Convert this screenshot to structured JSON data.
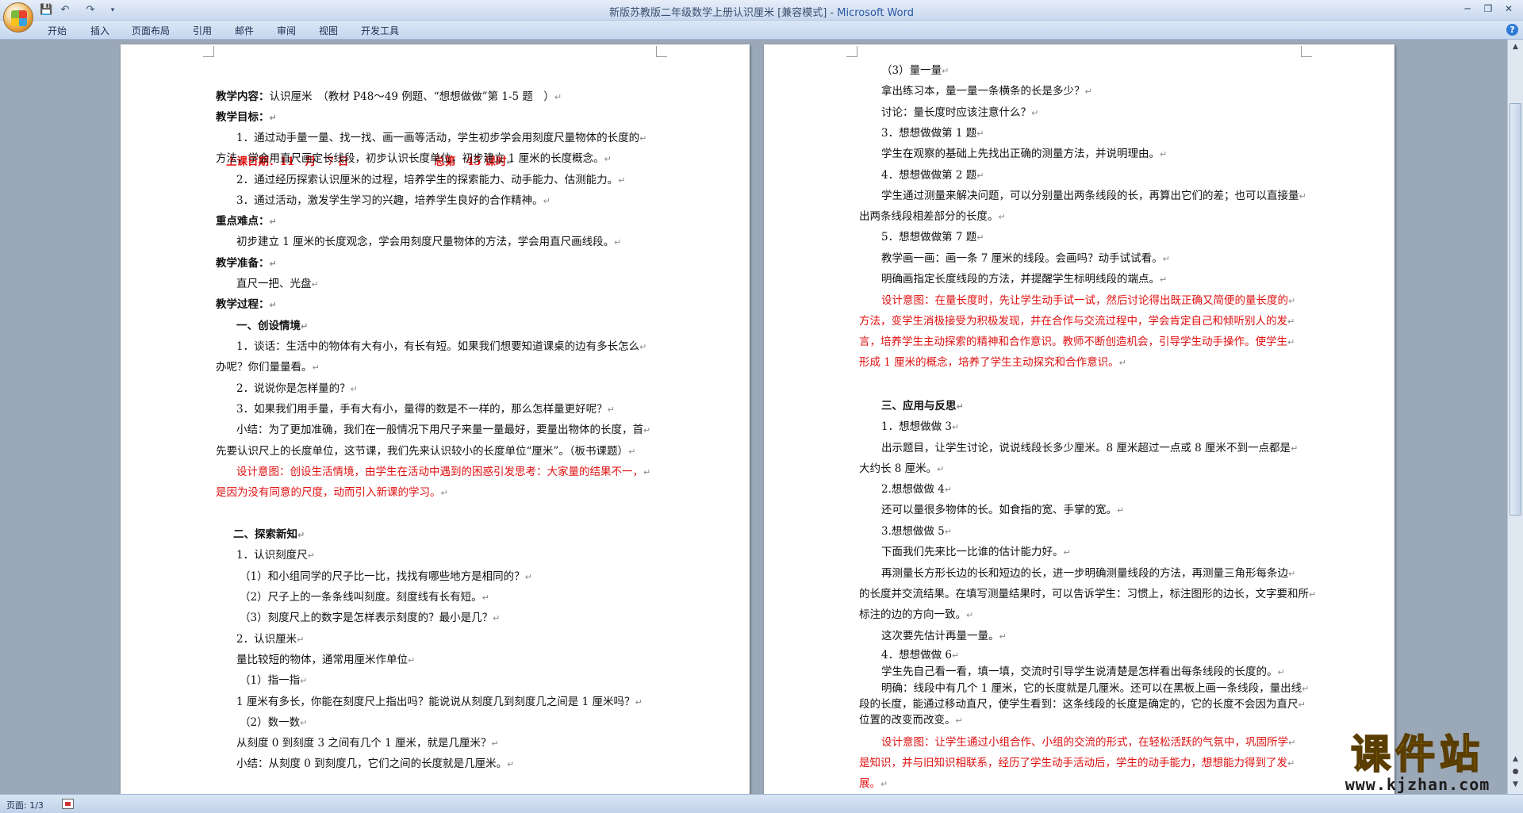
{
  "window": {
    "title": "新版苏教版二年级数学上册认识厘米 [兼容模式] - ",
    "app_name": "Microsoft Word",
    "quick_access": [
      "save-icon",
      "undo-icon",
      "redo-icon",
      "customize-icon"
    ],
    "controls": [
      "minimize",
      "restore",
      "close"
    ]
  },
  "ribbon": {
    "tabs": [
      "开始",
      "插入",
      "页面布局",
      "引用",
      "邮件",
      "审阅",
      "视图",
      "开发工具"
    ]
  },
  "status": {
    "page": "页面: 1/3"
  },
  "watermark": {
    "title": "课件站",
    "url": "www.kjzhan.com"
  },
  "page1": [
    "上课日期：11　月　7 日　　　　　　　　总第　45 课时",
    "教学内容：认识厘米　（教材 P48～49 例题、“想想做做”第 1-5 题　）",
    "教学目标：",
    "1．通过动手量一量、找一找、画一画等活动，学生初步学会用刻度尺量物体的长度的",
    "方法，学会用直尺画定长线段，初步认识长度单位，初步建立 1 厘米的长度概念。",
    "2．通过经历探索认识厘米的过程，培养学生的探索能力、动手能力、估测能力。",
    "3．通过活动，激发学生学习的兴趣，培养学生良好的合作精神。",
    "重点难点：",
    "初步建立 1 厘米的长度观念，学会用刻度尺量物体的方法，学会用直尺画线段。",
    "教学准备：",
    "直尺一把、光盘",
    "教学过程：",
    "一、创设情境",
    "1．谈话：生活中的物体有大有小，有长有短。如果我们想要知道课桌的边有多长怎么",
    "办呢？你们量量看。",
    "2．说说你是怎样量的？",
    "3．如果我们用手量，手有大有小，量得的数是不一样的，那么怎样量更好呢？",
    "小结：为了更加准确，我们在一般情况下用尺子来量一量最好，要量出物体的长度，首",
    "先要认识尺上的长度单位，这节课，我们先来认识较小的长度单位“厘米”。（板书课题）",
    "设计意图：创设生活情境，由学生在活动中遇到的困惑引发思考：大家量的结果不一，",
    "是因为没有同意的尺度，动而引入新课的学习。",
    "二、探索新知",
    "1．认识刻度尺",
    "（1）和小组同学的尺子比一比，找找有哪些地方是相同的？",
    "（2）尺子上的一条条线叫刻度。刻度线有长有短。",
    "（3）刻度尺上的数字是怎样表示刻度的？最小是几？",
    "2．认识厘米",
    "量比较短的物体，通常用厘米作单位",
    "（1）指一指",
    "1 厘米有多长，你能在刻度尺上指出吗？能说说从刻度几到刻度几之间是 1 厘米吗？",
    "（2）数一数",
    "从刻度 0 到刻度 3 之间有几个 1 厘米，就是几厘米？",
    "小结：从刻度 0 到刻度几，它们之间的长度就是几厘米。"
  ],
  "page2": [
    "（3）量一量",
    "拿出练习本，量一量一条横条的长是多少？",
    "讨论：量长度时应该注意什么？",
    "3．想想做做第 1 题",
    "学生在观察的基础上先找出正确的测量方法，并说明理由。",
    "4．想想做做第 2 题",
    "学生通过测量来解决问题，可以分别量出两条线段的长，再算出它们的差；也可以直接量",
    "出两条线段相差部分的长度。",
    "5．想想做做第 7 题",
    "教学画一画：画一条 7 厘米的线段。会画吗？动手试试看。",
    "明确画指定长度线段的方法，并提醒学生标明线段的端点。",
    "设计意图：在量长度时，先让学生动手试一试，然后讨论得出既正确又简便的量长度的",
    "方法，变学生消极接受为积极发现，并在合作与交流过程中，学会肯定自己和倾听别人的发",
    "言，培养学生主动探索的精神和合作意识。教师不断创造机会，引导学生动手操作。使学生",
    "形成 1 厘米的概念，培养了学生主动探究和合作意识。",
    "三、应用与反思",
    "1．想想做做 3",
    "出示题目，让学生讨论，说说线段长多少厘米。8 厘米超过一点或 8 厘米不到一点都是",
    "大约长 8 厘米。",
    "2.想想做做 4",
    "还可以量很多物体的长。如食指的宽、手掌的宽。",
    "3.想想做做 5",
    "下面我们先来比一比谁的估计能力好。",
    "再测量长方形长边的长和短边的长，进一步明确测量线段的方法，再测量三角形每条边",
    "的长度并交流结果。在填写测量结果时，可以告诉学生：习惯上，标注图形的边长，文字要和所",
    "标注的边的方向一致。",
    "这次要先估计再量一量。",
    "4．想想做做 6",
    "学生先自己看一看，填一填，交流时引导学生说清楚是怎样看出每条线段的长度的。",
    "明确：线段中有几个 1 厘米，它的长度就是几厘米。还可以在黑板上画一条线段，量出线",
    "段的长度，能通过移动直尺，使学生看到：这条线段的长度是确定的，它的长度不会因为直尺",
    "位置的改变而改变。",
    "设计意图：让学生通过小组合作、小组的交流的形式，在轻松活跃的气氛中，巩固所学",
    "是知识，并与旧知识相联系，经历了学生动手活动后，学生的动手能力，想想能力得到了发",
    "展。"
  ]
}
